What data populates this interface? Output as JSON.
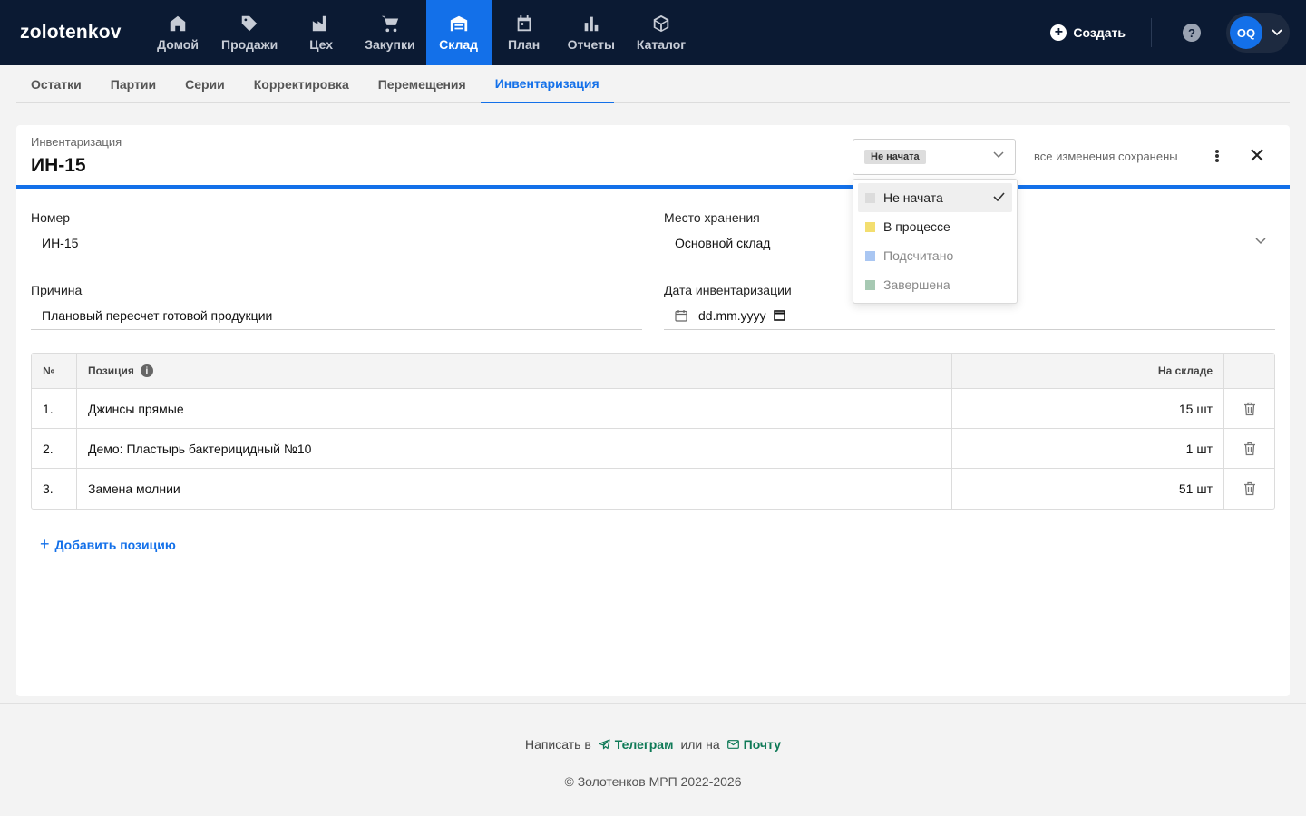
{
  "brand": "zolotenkov",
  "nav": [
    {
      "label": "Домой",
      "icon": "home-icon",
      "active": false
    },
    {
      "label": "Продажи",
      "icon": "tag-icon",
      "active": false
    },
    {
      "label": "Цех",
      "icon": "factory-icon",
      "active": false
    },
    {
      "label": "Закупки",
      "icon": "cart-icon",
      "active": false
    },
    {
      "label": "Склад",
      "icon": "warehouse-icon",
      "active": true
    },
    {
      "label": "План",
      "icon": "calendar-icon",
      "active": false
    },
    {
      "label": "Отчеты",
      "icon": "bar-chart-icon",
      "active": false
    },
    {
      "label": "Каталог",
      "icon": "box-icon",
      "active": false
    }
  ],
  "topbar": {
    "create_label": "Создать",
    "avatar_initials": "OQ"
  },
  "subtabs": [
    {
      "label": "Остатки",
      "active": false
    },
    {
      "label": "Партии",
      "active": false
    },
    {
      "label": "Серии",
      "active": false
    },
    {
      "label": "Корректировка",
      "active": false
    },
    {
      "label": "Перемещения",
      "active": false
    },
    {
      "label": "Инвентаризация",
      "active": true
    }
  ],
  "doc": {
    "subtitle": "Инвентаризация",
    "title": "ИН-15",
    "status": "Не начата",
    "saved_text": "все изменения сохранены"
  },
  "form": {
    "number_label": "Номер",
    "number_value": "ИН-15",
    "storage_label": "Место хранения",
    "storage_value": "Основной склад",
    "reason_label": "Причина",
    "reason_value": "Плановый пересчет готовой продукции",
    "date_label": "Дата инвентаризации",
    "date_value": "dd.mm.yyyy"
  },
  "table": {
    "headers": {
      "num": "№",
      "position": "Позиция",
      "qty": "На складе"
    },
    "rows": [
      {
        "num": "1.",
        "position": "Джинсы прямые",
        "qty": "15 шт"
      },
      {
        "num": "2.",
        "position": "Демо: Пластырь бактерицидный №10",
        "qty": "1 шт"
      },
      {
        "num": "3.",
        "position": "Замена молнии",
        "qty": "51 шт"
      }
    ]
  },
  "add_position_label": "Добавить позицию",
  "status_dropdown": {
    "options": [
      {
        "label": "Не начата",
        "color": "#dcdcdc",
        "selected": true,
        "muted": false
      },
      {
        "label": "В процессе",
        "color": "#f3de6f",
        "selected": false,
        "muted": false
      },
      {
        "label": "Подсчитано",
        "color": "#a9c6f2",
        "selected": false,
        "muted": true
      },
      {
        "label": "Завершена",
        "color": "#a7c9b3",
        "selected": false,
        "muted": true
      }
    ]
  },
  "footer": {
    "write_in": "Написать в",
    "telegram": "Телеграм",
    "or_on": "или на",
    "mail": "Почту",
    "copyright": "© Золотенков МРП 2022-2026"
  },
  "colors": {
    "navbar": "#0b1a33",
    "accent": "#1370e9",
    "link_green": "#0f7a57"
  }
}
